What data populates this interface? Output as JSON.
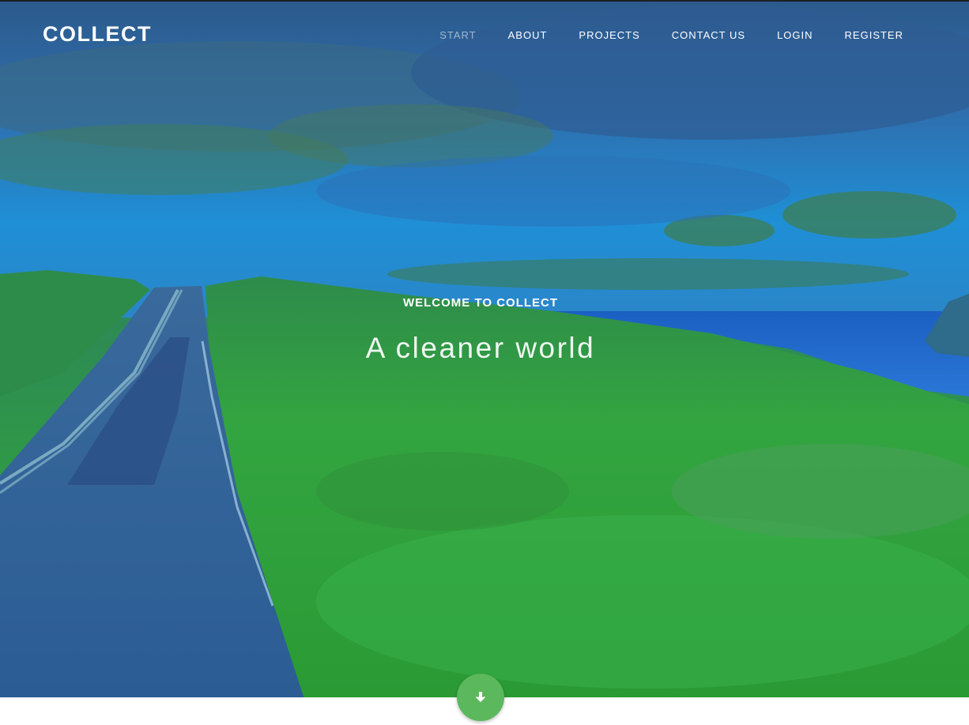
{
  "brand": {
    "name": "COLLECT"
  },
  "nav": {
    "items": [
      {
        "label": "START",
        "active": true
      },
      {
        "label": "ABOUT",
        "active": false
      },
      {
        "label": "PROJECTS",
        "active": false
      },
      {
        "label": "CONTACT US",
        "active": false
      },
      {
        "label": "LOGIN",
        "active": false
      },
      {
        "label": "REGISTER",
        "active": false
      }
    ]
  },
  "hero": {
    "welcome": "WELCOME TO COLLECT",
    "tagline": "A cleaner world",
    "scroll_icon": "arrow-down-icon"
  },
  "colors": {
    "accent": "#5cb85c",
    "nav_text": "#ffffff",
    "overlay_blue": "#2a6fc0",
    "overlay_green": "#2f9b45"
  }
}
